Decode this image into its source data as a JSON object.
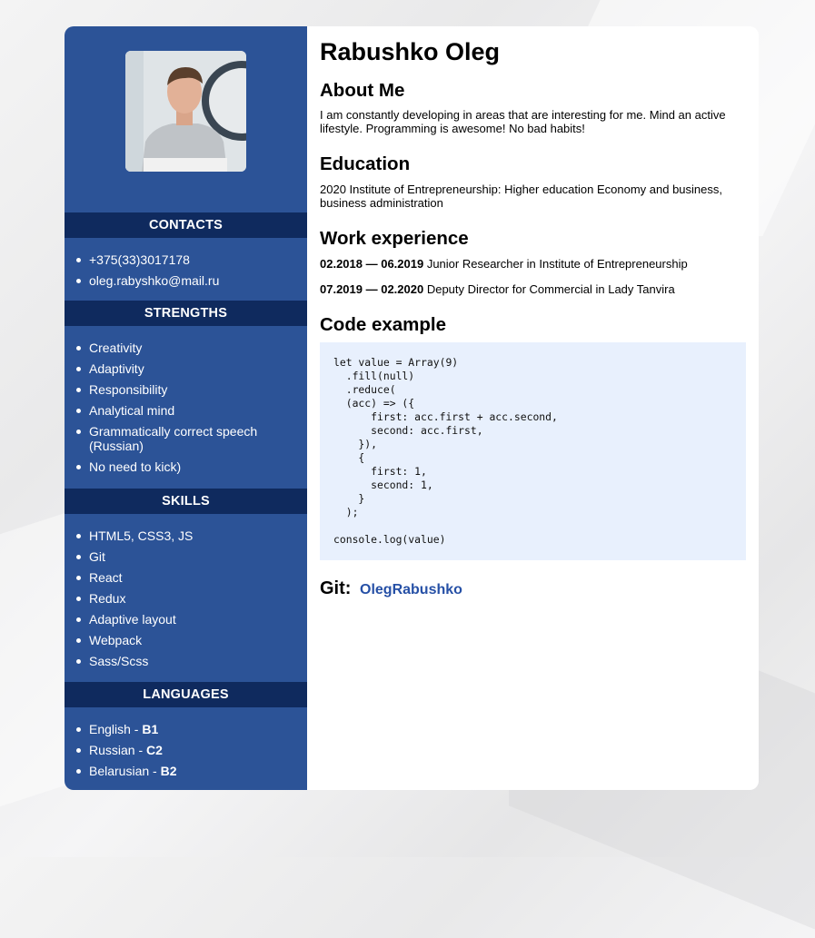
{
  "name": "Rabushko Oleg",
  "photo_alt": "Profile photo",
  "sidebar": {
    "contacts": {
      "heading": "CONTACTS",
      "items": [
        "+375(33)3017178",
        "oleg.rabyshko@mail.ru"
      ]
    },
    "strengths": {
      "heading": "STRENGTHS",
      "items": [
        "Creativity",
        "Adaptivity",
        "Responsibility",
        "Analytical mind",
        "Grammatically correct speech (Russian)",
        "No need to kick)"
      ]
    },
    "skills": {
      "heading": "SKILLS",
      "items": [
        "HTML5, CSS3, JS",
        "Git",
        "React",
        "Redux",
        "Adaptive layout",
        "Webpack",
        "Sass/Scss"
      ]
    },
    "languages": {
      "heading": "LANGUAGES",
      "items": [
        {
          "name": "English - ",
          "level": "B1"
        },
        {
          "name": "Russian - ",
          "level": "C2"
        },
        {
          "name": "Belarusian - ",
          "level": "B2"
        }
      ]
    }
  },
  "main": {
    "about": {
      "heading": "About Me",
      "text": "I am constantly developing in areas that are interesting for me. Mind an active lifestyle. Programming is awesome! No bad habits!"
    },
    "education": {
      "heading": "Education",
      "text": "2020 Institute of Entrepreneurship: Higher education Economy and business, business administration"
    },
    "work": {
      "heading": "Work experience",
      "items": [
        {
          "period": "02.2018 — 06.2019",
          "text": " Junior Researcher in Institute of Entrepreneurship"
        },
        {
          "period": "07.2019 — 02.2020",
          "text": " Deputy Director for Commercial in Lady Tanvira"
        }
      ]
    },
    "code": {
      "heading": "Code example",
      "text": "let value = Array(9)\n  .fill(null)\n  .reduce(\n  (acc) => ({\n      first: acc.first + acc.second,\n      second: acc.first,\n    }),\n    {\n      first: 1,\n      second: 1,\n    }\n  );\n\nconsole.log(value)"
    },
    "git": {
      "label": "Git:",
      "link_text": "OlegRabushko"
    }
  },
  "colors": {
    "sidebar_bg": "#2c5397",
    "sidebar_heading_bg": "#0f2a5e",
    "code_bg": "#e8f0fd",
    "link": "#2650a6"
  }
}
